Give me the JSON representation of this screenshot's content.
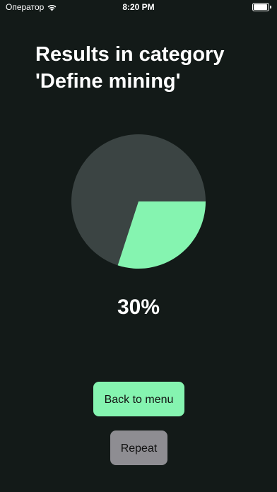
{
  "status_bar": {
    "carrier": "Оператор",
    "time": "8:20 PM",
    "icons": [
      "wifi-icon",
      "battery-icon"
    ]
  },
  "title": "Results in category 'Define mining'",
  "result": {
    "percent_label": "30%",
    "fraction": 0.3
  },
  "colors": {
    "background": "#131a18",
    "pie_remaining": "#3b4443",
    "pie_score": "#85f4b0",
    "primary_button": "#85f4b0",
    "secondary_button": "#8e8d92"
  },
  "buttons": {
    "back": "Back to menu",
    "repeat": "Repeat"
  }
}
